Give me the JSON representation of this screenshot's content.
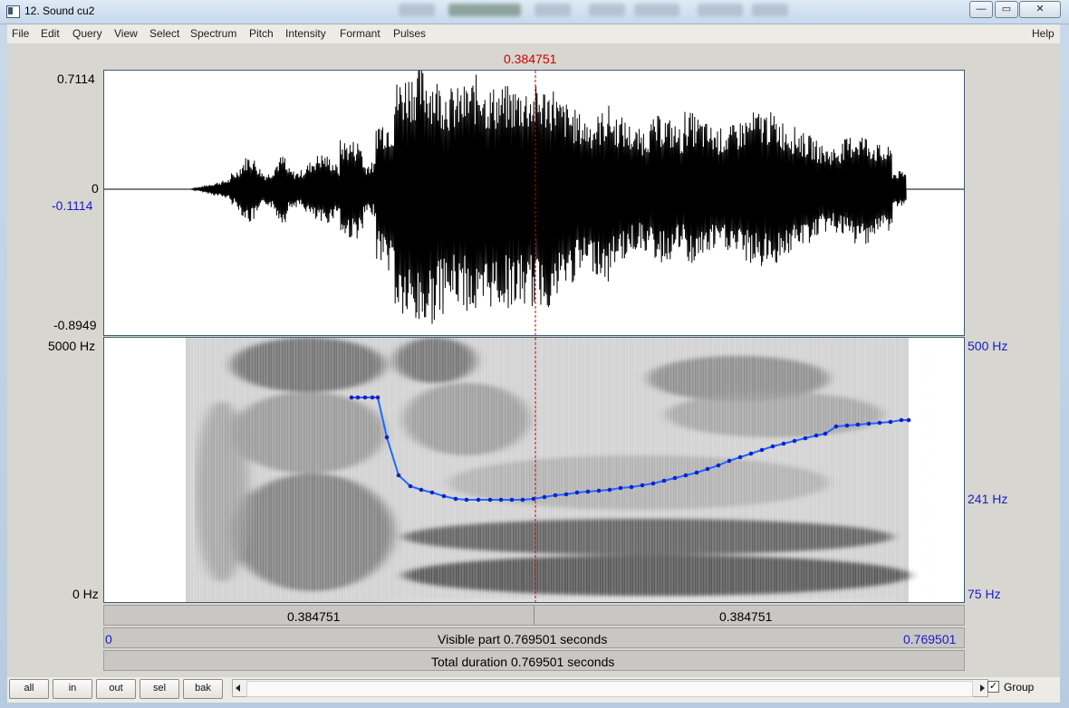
{
  "window": {
    "title": "12. Sound cu2",
    "minimize_label": "—",
    "maximize_label": "▭",
    "close_label": "✕"
  },
  "menu": {
    "items": [
      "File",
      "Edit",
      "Query",
      "View",
      "Select",
      "Spectrum",
      "Pitch",
      "Intensity",
      "Formant",
      "Pulses"
    ],
    "help": "Help"
  },
  "cursor": {
    "time_label": "0.384751"
  },
  "waveform": {
    "y_max": "0.7114",
    "y_zero": "0",
    "y_cursor_value": "-0.1114",
    "y_min": "-0.8949"
  },
  "spectrogram": {
    "freq_top": "5000 Hz",
    "freq_bottom": "0 Hz",
    "pitch_top": "500 Hz",
    "pitch_mid": "241 Hz",
    "pitch_bottom": "75 Hz"
  },
  "time_bar": {
    "left_segment": "0.384751",
    "right_segment": "0.384751"
  },
  "visible_bar": {
    "start": "0",
    "text": "Visible part 0.769501 seconds",
    "end": "0.769501"
  },
  "total_bar": {
    "text": "Total duration 0.769501 seconds"
  },
  "buttons": {
    "all": "all",
    "in": "in",
    "out": "out",
    "sel": "sel",
    "bak": "bak"
  },
  "group": {
    "label": "Group",
    "checked": true
  },
  "colors": {
    "cursor": "#d10000",
    "pitch": "#1a1cc8",
    "waveform": "#000000"
  }
}
